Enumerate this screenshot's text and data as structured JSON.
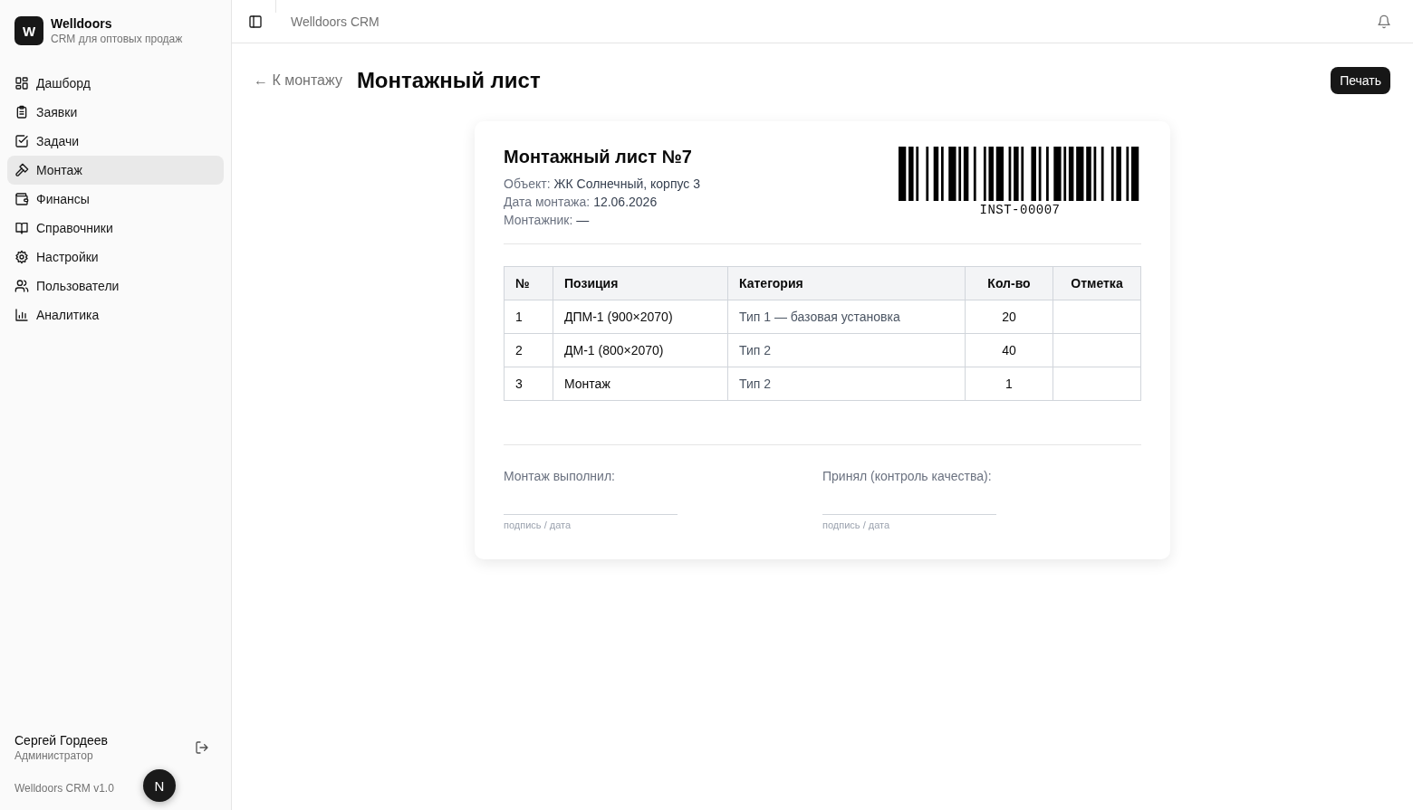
{
  "brand": {
    "logo": "W",
    "name": "Welldoors",
    "subtitle": "CRM для оптовых продаж"
  },
  "nav": [
    {
      "label": "Дашборд",
      "selected": false
    },
    {
      "label": "Заявки",
      "selected": false
    },
    {
      "label": "Задачи",
      "selected": false
    },
    {
      "label": "Монтаж",
      "selected": true
    },
    {
      "label": "Финансы",
      "selected": false
    },
    {
      "label": "Справочники",
      "selected": false
    },
    {
      "label": "Настройки",
      "selected": false
    },
    {
      "label": "Пользователи",
      "selected": false
    },
    {
      "label": "Аналитика",
      "selected": false
    }
  ],
  "user": {
    "name": "Сергей Гордеев",
    "role": "Администратор"
  },
  "version": "Welldoors CRM v1.0",
  "dev_badge": "N",
  "header": {
    "title": "Welldoors CRM"
  },
  "page": {
    "back": "← К монтажу",
    "title": "Монтажный лист",
    "print": "Печать"
  },
  "sheet": {
    "title": "Монтажный лист №7",
    "meta": [
      {
        "label": "Объект:",
        "value": "ЖК Солнечный, корпус 3"
      },
      {
        "label": "Дата монтажа:",
        "value": "12.06.2026"
      },
      {
        "label": "Монтажник:",
        "value": "—"
      }
    ],
    "barcode": "INST-00007",
    "columns": [
      "№",
      "Позиция",
      "Категория",
      "Кол-во",
      "Отметка"
    ],
    "rows": [
      [
        "1",
        "ДПМ-1 (900×2070)",
        "Тип 1 — базовая установка",
        "20",
        ""
      ],
      [
        "2",
        "ДМ-1 (800×2070)",
        "Тип 2",
        "40",
        ""
      ],
      [
        "3",
        "Монтаж",
        "Тип 2",
        "1",
        ""
      ]
    ],
    "signatures": [
      {
        "label": "Монтаж выполнил:",
        "hint": "подпись / дата"
      },
      {
        "label": "Принял (контроль качества):",
        "hint": "подпись / дата"
      }
    ]
  }
}
